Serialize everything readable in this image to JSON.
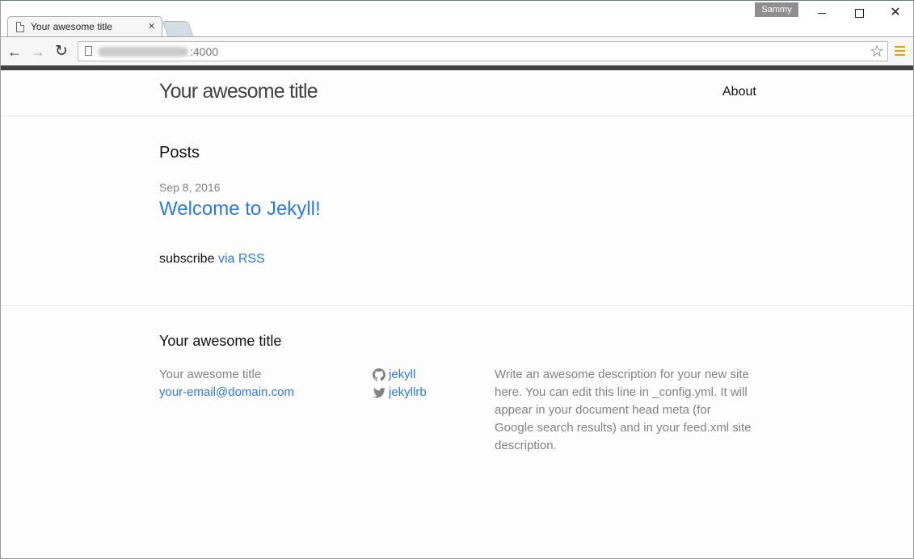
{
  "browser": {
    "tab_title": "Your awesome title",
    "tab_close": "×",
    "profile_name": "Sammy",
    "url_suffix": ":4000",
    "back_glyph": "←",
    "forward_glyph": "→",
    "reload_glyph": "↻",
    "star_glyph": "☆",
    "close_glyph": "✕",
    "icons": {
      "tab": "page-icon",
      "back": "arrow-left-icon",
      "forward": "arrow-right-icon",
      "reload": "reload-icon",
      "bookmark": "star-icon",
      "menu": "hamburger-menu-icon"
    },
    "menu_color": "#e8a000"
  },
  "site": {
    "title": "Your awesome title",
    "nav": {
      "about_label": "About"
    },
    "accent_bar_color": "#424242",
    "link_color": "#2a7ae2"
  },
  "content": {
    "posts_heading": "Posts",
    "post": {
      "date": "Sep 8, 2016",
      "title": "Welcome to Jekyll!"
    },
    "subscribe_text": "subscribe",
    "rss_link": "via RSS"
  },
  "footer": {
    "heading": "Your awesome title",
    "name": "Your awesome title",
    "email": "your-email@domain.com",
    "github": {
      "icon": "github-icon",
      "username": "jekyll"
    },
    "twitter": {
      "icon": "twitter-icon",
      "username": "jekyllrb"
    },
    "description": "Write an awesome description for your new site here. You can edit this line in _config.yml. It will appear in your document head meta (for Google search results) and in your feed.xml site description."
  }
}
